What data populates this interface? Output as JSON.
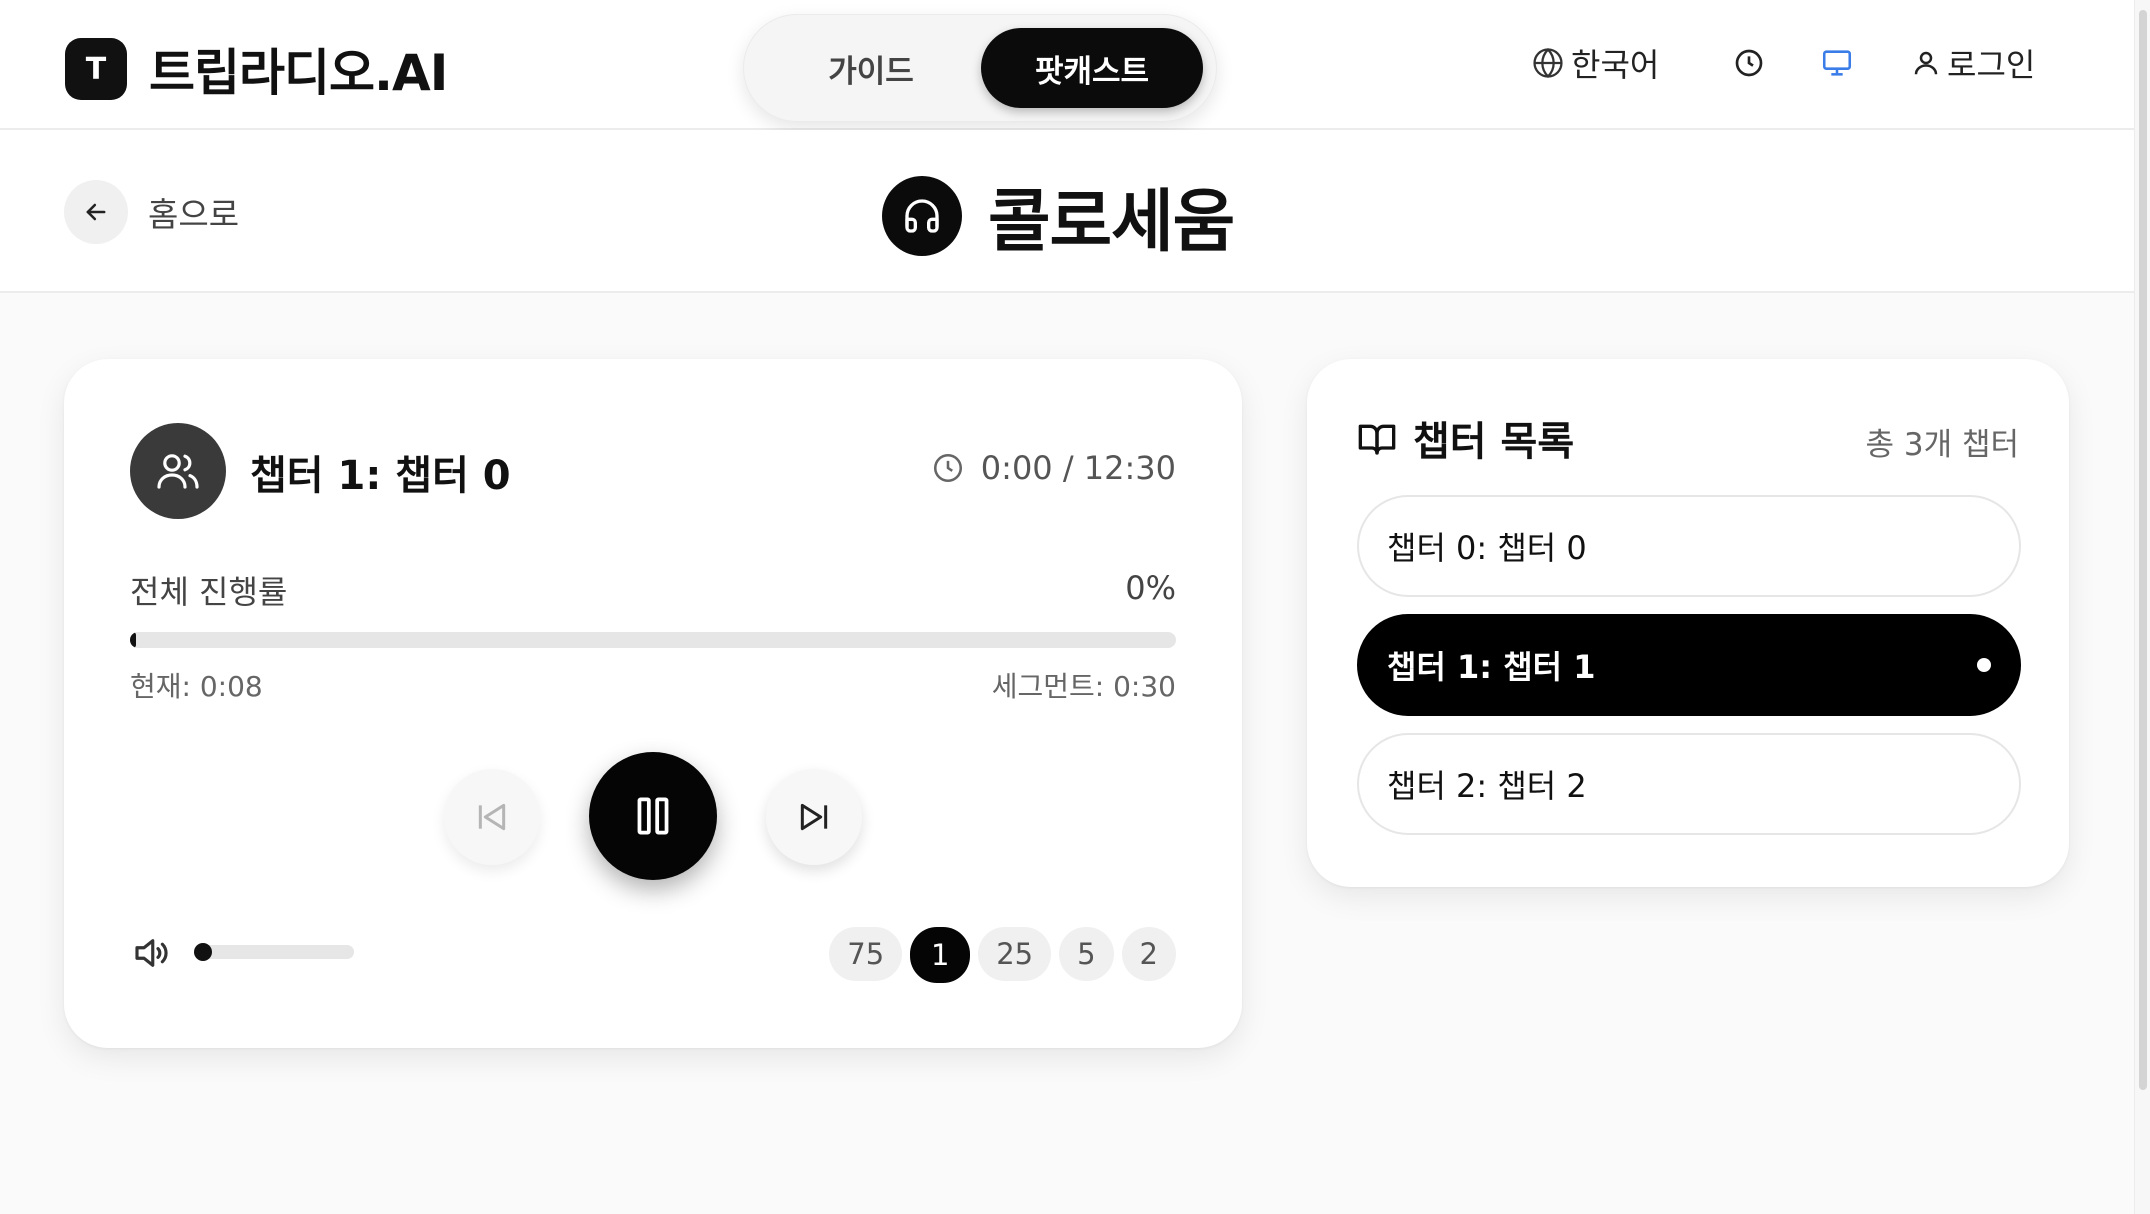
{
  "brand": {
    "mark": "T",
    "name": "트립라디오.AI"
  },
  "mode_tabs": {
    "guide": "가이드",
    "podcast": "팟캐스트"
  },
  "header": {
    "language": "한국어",
    "login": "로그인"
  },
  "subheader": {
    "back_label": "홈으로",
    "title": "콜로세움"
  },
  "player": {
    "now_playing": "챕터 1: 챕터 0",
    "time": "0:00 / 12:30",
    "progress_label": "전체 진행률",
    "progress_percent": "0%",
    "progress_value": 0,
    "current_position": "현재: 0:08",
    "segment_length": "세그먼트: 0:30",
    "is_playing": true,
    "volume_value": 0,
    "speeds": [
      "75",
      "1",
      "25",
      "5",
      "2"
    ],
    "active_speed": "1"
  },
  "chapters": {
    "heading": "챕터 목록",
    "count": "총 3개 챕터",
    "items": [
      {
        "label": "챕터 0: 챕터 0",
        "active": false
      },
      {
        "label": "챕터 1: 챕터 1",
        "active": true
      },
      {
        "label": "챕터 2: 챕터 2",
        "active": false
      }
    ]
  },
  "colors": {
    "accent": "#000000",
    "display_icon": "#3b7de8",
    "track": "#e6e6e6"
  },
  "icons": {
    "language": "globe-icon",
    "history": "clock-icon",
    "display": "monitor-icon",
    "login": "user-icon",
    "back": "arrow-left-icon",
    "title_badge": "headphones-icon",
    "speaker": "users-icon",
    "time": "clock-icon",
    "prev": "skip-back-icon",
    "play": "pause-icon",
    "next": "skip-forward-icon",
    "volume": "volume-icon",
    "chapters": "book-open-icon"
  }
}
